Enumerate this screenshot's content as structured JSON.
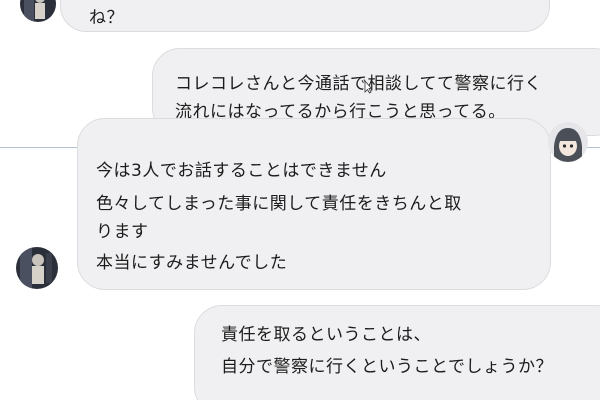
{
  "messages": [
    {
      "id": "m1",
      "direction": "incoming",
      "lines": [
        "ね？"
      ]
    },
    {
      "id": "m2",
      "direction": "outgoing",
      "lines": [
        "コレコレさんと今通話で相談してて警察に行く",
        "流れにはなってるから行こうと思ってる。"
      ]
    },
    {
      "id": "m3",
      "direction": "incoming",
      "lines": [
        "今は3人でお話することはできません",
        "色々してしまった事に関して責任をきちんと取",
        "ります",
        "本当にすみませんでした"
      ]
    },
    {
      "id": "m4",
      "direction": "outgoing",
      "lines": [
        "責任を取るということは、",
        "自分で警察に行くということでしょうか？"
      ]
    }
  ],
  "colors": {
    "bubble_bg": "#f0f0f2",
    "bubble_border": "#dcdce0",
    "text": "#1c1c1c",
    "divider": "#b8c2d6"
  },
  "icons": {
    "avatar_1": "dark-figure-avatar-icon",
    "avatar_2": "anime-girl-avatar-icon",
    "avatar_3": "dark-figure-avatar-icon",
    "cursor": "mouse-cursor-icon"
  }
}
